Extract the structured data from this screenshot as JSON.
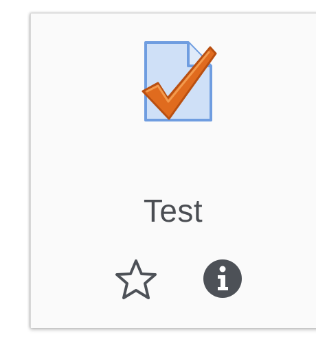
{
  "activity": {
    "title": "Test",
    "icon": "quiz-document-checkmark-icon",
    "actions": {
      "star_icon": "star-outline-icon",
      "info_icon": "info-circle-icon"
    }
  },
  "colors": {
    "title_text": "#4a4d52",
    "icon_paper_fill": "#cfe0f7",
    "icon_paper_stroke": "#6f9de0",
    "checkmark": "#e06b1e",
    "action_icon": "#4d5157"
  }
}
